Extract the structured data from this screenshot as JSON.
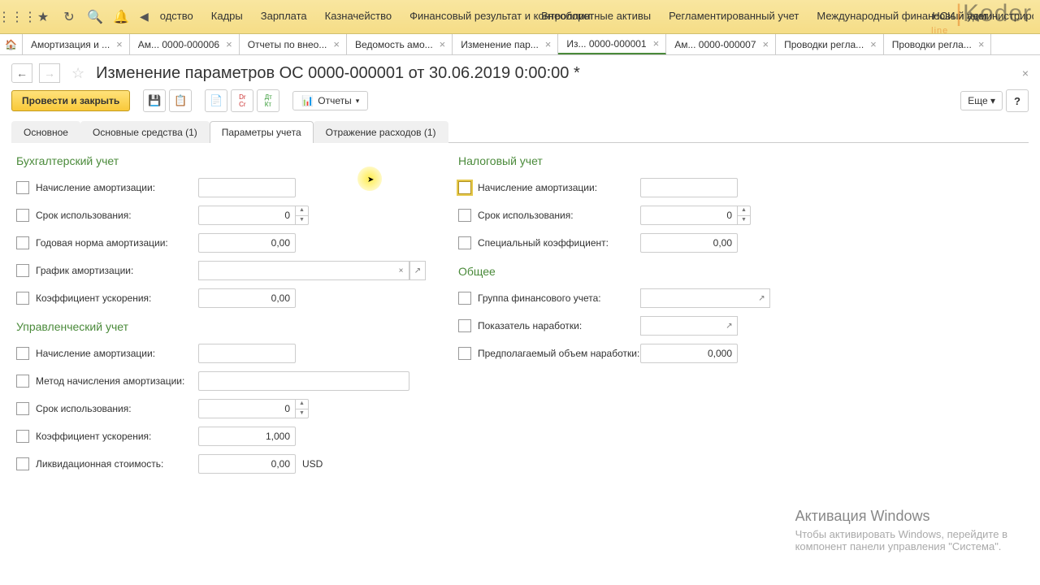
{
  "topbar": {
    "menu": [
      "одство",
      "Кадры",
      "Зарплата",
      "Казначейство",
      "Финансовый результат и контроллинг",
      "Внеоборотные активы",
      "Регламентированный учет",
      "Международный финансовый учет",
      "НСИ и администрирование"
    ]
  },
  "logo": {
    "brand": "Koder",
    "sub": "line"
  },
  "tabs": [
    {
      "label": "Амортизация и ..."
    },
    {
      "label": "Ам... 0000-000006"
    },
    {
      "label": "Отчеты по внео..."
    },
    {
      "label": "Ведомость амо..."
    },
    {
      "label": "Изменение пар..."
    },
    {
      "label": "Из... 0000-000001",
      "active": true
    },
    {
      "label": "Ам... 0000-000007"
    },
    {
      "label": "Проводки регла..."
    },
    {
      "label": "Проводки регла..."
    }
  ],
  "header": {
    "title": "Изменение параметров ОС 0000-000001 от 30.06.2019 0:00:00 *"
  },
  "toolbar": {
    "primary": "Провести и закрыть",
    "reports": "Отчеты",
    "more": "Еще",
    "help": "?"
  },
  "doc_tabs": [
    {
      "label": "Основное"
    },
    {
      "label": "Основные средства (1)"
    },
    {
      "label": "Параметры учета",
      "active": true
    },
    {
      "label": "Отражение расходов (1)"
    }
  ],
  "sections": {
    "accounting": "Бухгалтерский учет",
    "management": "Управленческий учет",
    "tax": "Налоговый учет",
    "general": "Общее"
  },
  "fields": {
    "accrual": "Начисление амортизации:",
    "useful_life": "Срок использования:",
    "annual_rate": "Годовая норма амортизации:",
    "schedule": "График амортизации:",
    "accel": "Коэффициент ускорения:",
    "method": "Метод начисления амортизации:",
    "salvage": "Ликвидационная стоимость:",
    "special_coef": "Специальный коэффициент:",
    "fin_group": "Группа финансового учета:",
    "usage_indicator": "Показатель наработки:",
    "expected_usage": "Предполагаемый объем наработки:"
  },
  "values": {
    "zero_int": "0",
    "zero_dec2": "0,00",
    "one_dec3": "1,000",
    "zero_dec3": "0,000",
    "currency": "USD"
  },
  "watermark": {
    "title": "Активация Windows",
    "text1": "Чтобы активировать Windows, перейдите в",
    "text2": "компонент панели управления \"Система\"."
  }
}
